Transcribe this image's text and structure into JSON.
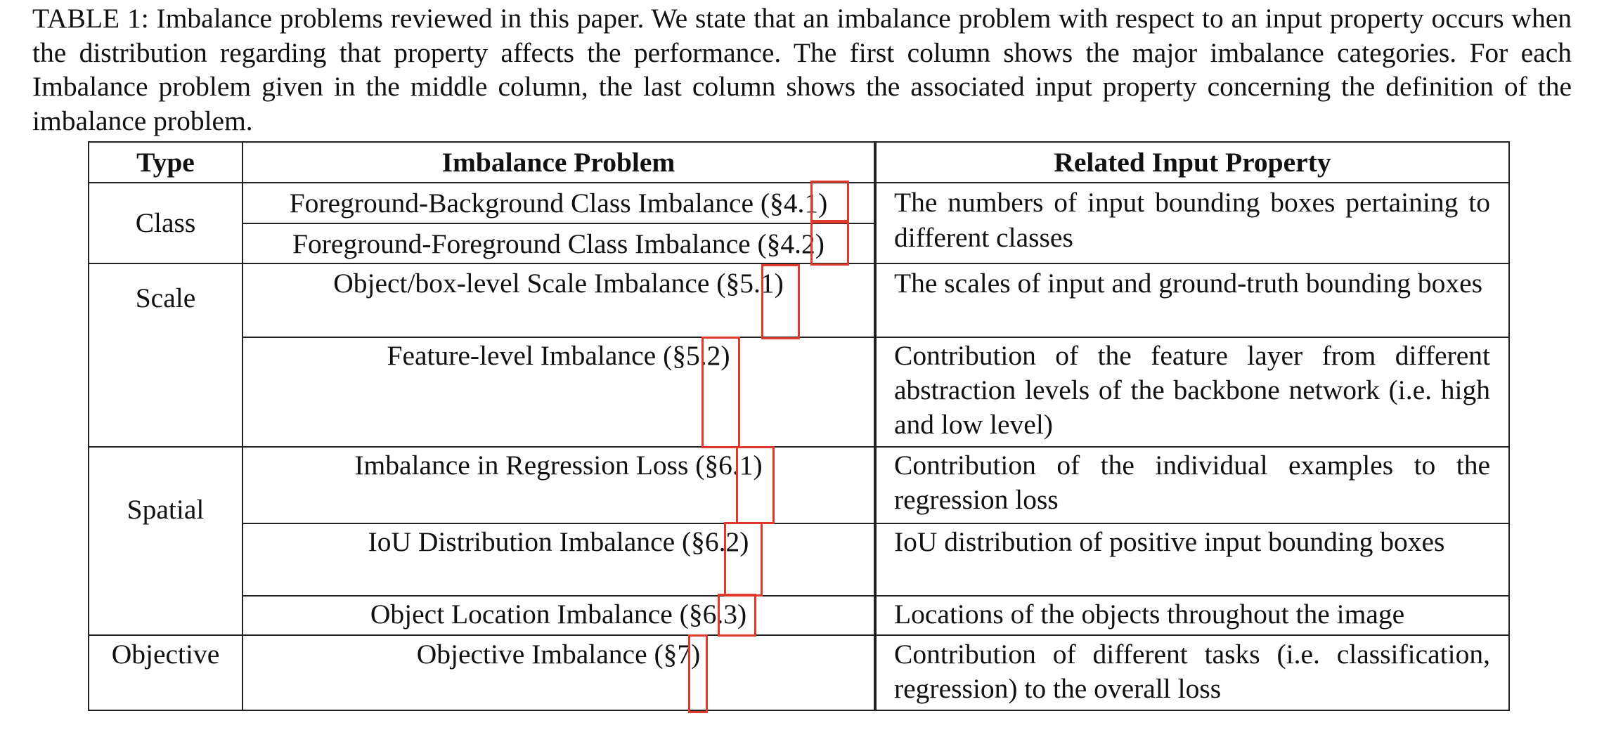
{
  "caption": "TABLE 1: Imbalance problems reviewed in this paper. We state that an imbalance problem with respect to an input property occurs when the distribution regarding that property affects the performance. The first column shows the major imbalance categories. For each Imbalance problem given in the middle column, the last column shows the associated input property concerning the definition of the imbalance problem.",
  "table": {
    "headers": [
      "Type",
      "Imbalance Problem",
      "Related Input Property"
    ],
    "groups": [
      {
        "type": "Class",
        "problems": [
          "Foreground-Background Class Imbalance (§4.1)",
          "Foreground-Foreground Class Imbalance (§4.2)"
        ],
        "properties": [
          "The numbers of input bounding boxes pertain­ing to different classes"
        ]
      },
      {
        "type": "Scale",
        "problems": [
          "Object/box-level Scale Imbalance (§5.1)",
          "Feature-level Imbalance (§5.2)"
        ],
        "properties": [
          "The scales of input and ground-truth bounding boxes",
          "Contribution of the feature layer from different abstraction levels of the backbone network (i.e. high and low level)"
        ]
      },
      {
        "type": "Spatial",
        "problems": [
          "Imbalance in Regression Loss (§6.1)",
          "IoU Distribution Imbalance (§6.2)",
          "Object Location Imbalance (§6.3)"
        ],
        "properties": [
          "Contribution of the individual examples to the regression loss",
          "IoU distribution of positive input bounding boxes",
          "Locations of the objects throughout the image"
        ]
      },
      {
        "type": "Objective",
        "problems": [
          "Objective Imbalance (§7)"
        ],
        "properties": [
          "Contribution of different tasks (i.e. classifica­tion, regression) to the overall loss"
        ]
      }
    ]
  },
  "highlight_color": "#e03a2e"
}
